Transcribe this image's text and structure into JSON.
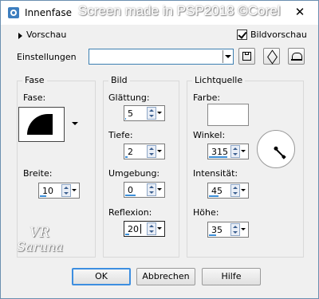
{
  "window": {
    "title": "Innenfase",
    "watermark": "Screen made in PSP2018 ©Corel",
    "close_glyph": "✕"
  },
  "preview": {
    "toggle_label": "Vorschau",
    "image_preview_label": "Bildvorschau",
    "image_preview_checked": true
  },
  "settings": {
    "label": "Einstellungen",
    "value": "",
    "icons": [
      "save-preset-icon",
      "preset-manager-icon",
      "reset-icon"
    ]
  },
  "fase_group": {
    "title": "Fase",
    "fase_label": "Fase:",
    "width_label": "Breite:",
    "width_value": "10",
    "width_fill": 0.3
  },
  "bild_group": {
    "title": "Bild",
    "smoothing_label": "Glättung:",
    "smoothing_value": "5",
    "smoothing_fill": 0.05,
    "depth_label": "Tiefe:",
    "depth_value": "2",
    "depth_fill": 0.1,
    "ambience_label": "Umgebung:",
    "ambience_value": "0",
    "ambience_fill": 0.5,
    "reflection_label": "Reflexion:",
    "reflection_value": "20",
    "reflection_fill": 0.2
  },
  "light_group": {
    "title": "Lichtquelle",
    "color_label": "Farbe:",
    "color_value": "#ffffff",
    "angle_label": "Winkel:",
    "angle_value": "315",
    "angle_fill": 0.87,
    "intensity_label": "Intensität:",
    "intensity_value": "45",
    "intensity_fill": 0.45,
    "height_label": "Höhe:",
    "height_value": "35",
    "height_fill": 0.35
  },
  "logo": {
    "line1": "VR",
    "line2": "Saruna"
  },
  "buttons": {
    "ok": "OK",
    "cancel": "Abbrechen",
    "help": "Hilfe"
  },
  "colors": {
    "accent": "#3d8ee0",
    "title_icon": "#3d7ebf"
  }
}
